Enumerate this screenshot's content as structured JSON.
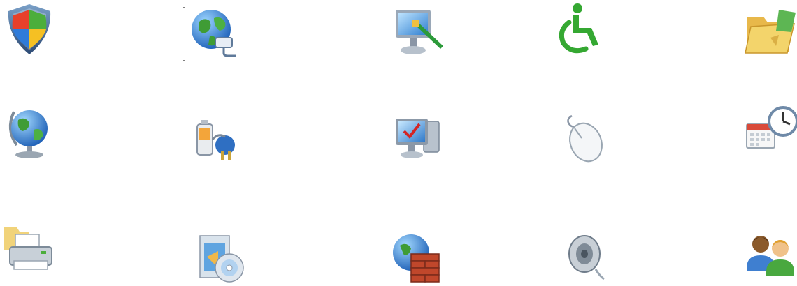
{
  "grid": {
    "rows": [
      {
        "icons": [
          "security-shield-icon",
          "network-globe-icon",
          "display-personalization-icon",
          "accessibility-icon",
          "folder-options-icon"
        ]
      },
      {
        "icons": [
          "regional-globe-icon",
          "power-options-icon",
          "system-monitor-icon",
          "mouse-icon",
          "date-time-icon"
        ]
      },
      {
        "icons": [
          "printer-icon",
          "programs-cd-icon",
          "firewall-icon",
          "sound-speaker-icon",
          "user-accounts-icon"
        ]
      }
    ]
  },
  "colors": {
    "background": "#ffffff",
    "shield_red": "#e8402a",
    "shield_green": "#4cae3b",
    "shield_blue": "#2f7bd9",
    "shield_yellow": "#f5c023",
    "accessibility_green": "#35a832",
    "folder_yellow": "#f3d46b",
    "firewall_brick": "#c0472b"
  }
}
